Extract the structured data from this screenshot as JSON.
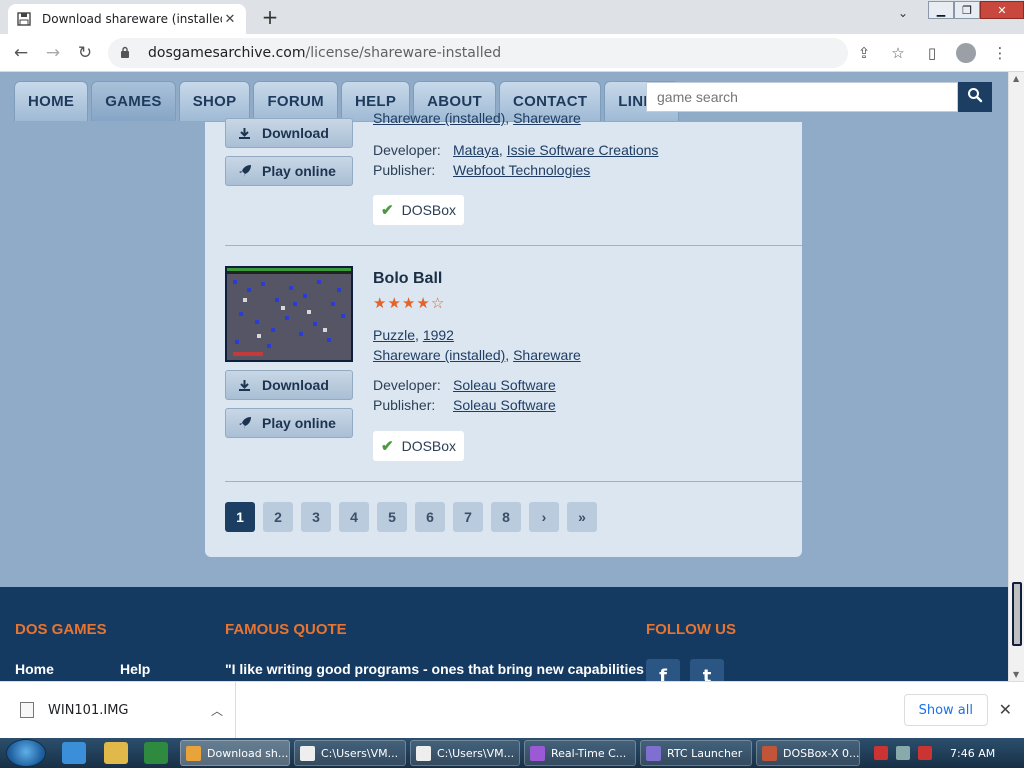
{
  "browser": {
    "tab_title": "Download shareware (installed) g",
    "url_domain": "dosgamesarchive.com",
    "url_path": "/license/shareware-installed"
  },
  "site_nav": {
    "items": [
      "HOME",
      "GAMES",
      "SHOP",
      "FORUM",
      "HELP",
      "ABOUT",
      "CONTACT",
      "LINKS"
    ],
    "active": "GAMES",
    "search_placeholder": "game search"
  },
  "games": [
    {
      "categories": [
        "Shareware (installed)",
        "Shareware"
      ],
      "download_label": "Download",
      "play_label": "Play online",
      "developer_label": "Developer:",
      "developers": [
        "Mataya",
        "Issie Software Creations"
      ],
      "publisher_label": "Publisher:",
      "publishers": [
        "Webfoot Technologies"
      ],
      "platform": "DOSBox"
    },
    {
      "title": "Bolo Ball",
      "rating": 4,
      "rating_max": 5,
      "genre": "Puzzle",
      "year": "1992",
      "categories": [
        "Shareware (installed)",
        "Shareware"
      ],
      "download_label": "Download",
      "play_label": "Play online",
      "developer_label": "Developer:",
      "developers": [
        "Soleau Software"
      ],
      "publisher_label": "Publisher:",
      "publishers": [
        "Soleau Software"
      ],
      "platform": "DOSBox"
    }
  ],
  "pagination": {
    "pages": [
      "1",
      "2",
      "3",
      "4",
      "5",
      "6",
      "7",
      "8"
    ],
    "current": "1",
    "next": "›",
    "last": "»"
  },
  "footer": {
    "col1_heading": "DOS GAMES",
    "col1_links": [
      "Home",
      "Help"
    ],
    "col2_heading": "FAMOUS QUOTE",
    "quote": "\"I like writing good programs - ones that bring new capabilities",
    "col3_heading": "FOLLOW US",
    "social": [
      "f",
      "t"
    ]
  },
  "download_bar": {
    "file_name": "WIN101.IMG",
    "show_all": "Show all"
  },
  "taskbar": {
    "tasks": [
      {
        "label": "Download sh...",
        "icon": "chrome-icon",
        "active": true
      },
      {
        "label": "C:\\Users\\VM...",
        "icon": "7zip-icon"
      },
      {
        "label": "C:\\Users\\VM...",
        "icon": "7zip-icon"
      },
      {
        "label": "Real-Time C...",
        "icon": "rtc-icon"
      },
      {
        "label": "RTC Launcher",
        "icon": "rtc-launcher-icon"
      },
      {
        "label": "DOSBox-X 0...",
        "icon": "dosbox-icon"
      }
    ],
    "clock": "7:46 AM"
  },
  "colors": {
    "page_bg": "#90abc8",
    "panel_bg": "#dbe6f1",
    "footer_bg": "#153a62",
    "accent_orange": "#e8742f",
    "nav_dark": "#1c3e63"
  }
}
